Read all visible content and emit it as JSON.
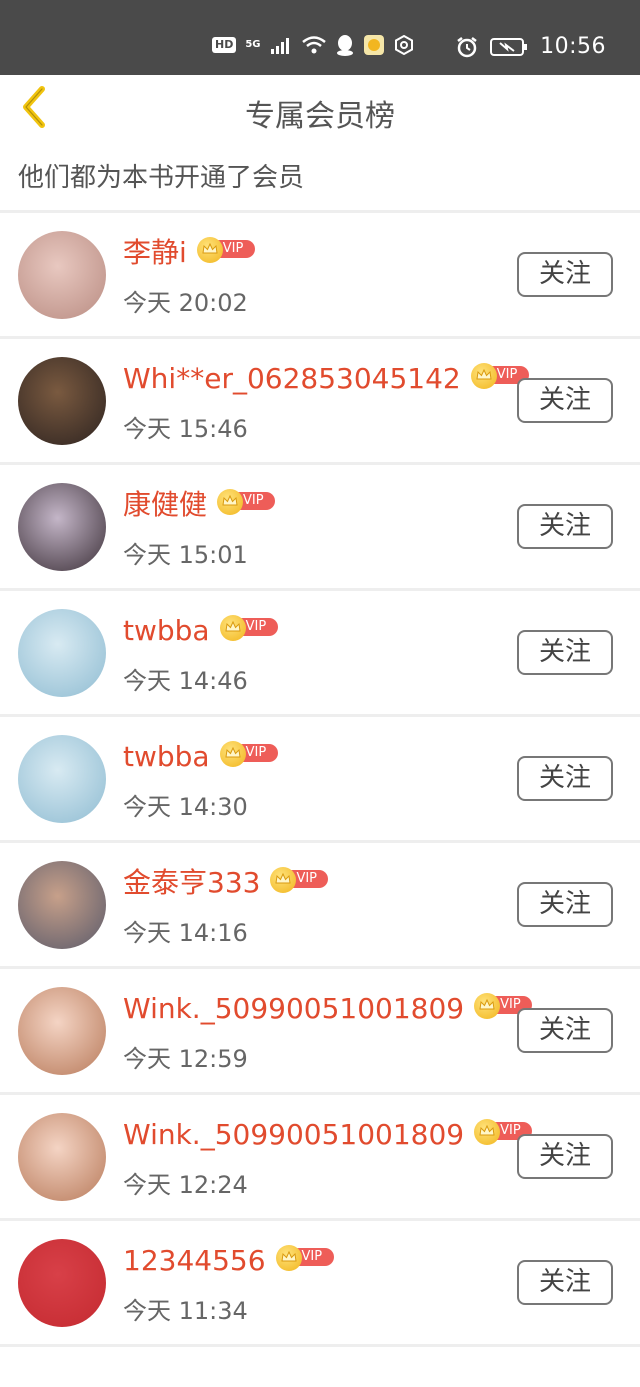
{
  "status_bar": {
    "hd": "HD",
    "network": "5G",
    "time": "10:56",
    "icons": [
      "hd-icon",
      "5g-icon",
      "signal-icon",
      "wifi-icon",
      "qq-icon",
      "app-icon",
      "settings-icon",
      "alarm-icon",
      "battery-icon"
    ]
  },
  "header": {
    "title": "专属会员榜",
    "back_icon": "chevron-left-icon"
  },
  "subtitle": "他们都为本书开通了会员",
  "follow_label": "关注",
  "vip_label": "VIP",
  "members": [
    {
      "name": "李静i",
      "time": "今天 20:02",
      "avatar_colors": [
        "#e8c8c0",
        "#b98c82"
      ]
    },
    {
      "name": "Whi**er_062853045142",
      "time": "今天 15:46",
      "avatar_colors": [
        "#7a5a40",
        "#2d2320"
      ]
    },
    {
      "name": "康健健",
      "time": "今天 15:01",
      "avatar_colors": [
        "#c4b6c8",
        "#3c3038"
      ]
    },
    {
      "name": "twbba",
      "time": "今天 14:46",
      "avatar_colors": [
        "#d8eaf2",
        "#8fbcd2"
      ]
    },
    {
      "name": "twbba",
      "time": "今天 14:30",
      "avatar_colors": [
        "#d8eaf2",
        "#8fbcd2"
      ]
    },
    {
      "name": "金泰亨333",
      "time": "今天 14:16",
      "avatar_colors": [
        "#c7a08a",
        "#5a5a6a"
      ]
    },
    {
      "name": "Wink._50990051001809",
      "time": "今天 12:59",
      "avatar_colors": [
        "#f4d4c4",
        "#b87a5a"
      ]
    },
    {
      "name": "Wink._50990051001809",
      "time": "今天 12:24",
      "avatar_colors": [
        "#f4d4c4",
        "#b87a5a"
      ]
    },
    {
      "name": "12344556",
      "time": "今天 11:34",
      "avatar_colors": [
        "#d84048",
        "#c42a30"
      ]
    }
  ],
  "colors": {
    "status_bar": "#4a4a4a",
    "accent_name": "#e14b2e",
    "back_chevron": "#f1c40f",
    "vip_pill": "#ee5d58"
  }
}
